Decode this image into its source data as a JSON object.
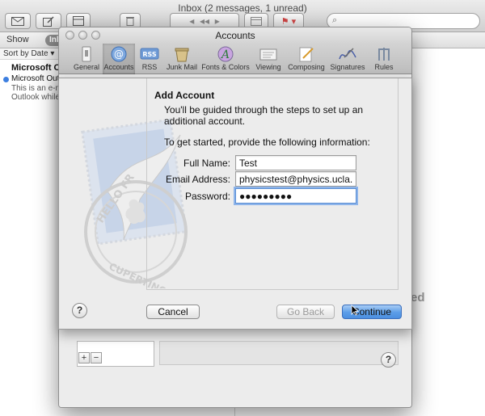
{
  "mail": {
    "window_title": "Inbox (2 messages, 1 unread)",
    "show_label": "Show",
    "inbox_pill": "Inbox",
    "sort_label": "Sort by Date ▾",
    "message": {
      "sender": "Microsoft Outlo",
      "subject": "Microsoft Outlo",
      "preview_line1": "This is an e-m",
      "preview_line2": "Outlook while"
    },
    "background_text": "ed"
  },
  "prefs": {
    "title": "Accounts",
    "tabs": [
      {
        "label": "General",
        "icon": "general-switch-icon"
      },
      {
        "label": "Accounts",
        "icon": "at-sign-icon"
      },
      {
        "label": "RSS",
        "icon": "rss-icon"
      },
      {
        "label": "Junk Mail",
        "icon": "junk-mail-icon"
      },
      {
        "label": "Fonts & Colors",
        "icon": "fonts-colors-icon"
      },
      {
        "label": "Viewing",
        "icon": "viewing-icon"
      },
      {
        "label": "Composing",
        "icon": "composing-icon"
      },
      {
        "label": "Signatures",
        "icon": "signatures-icon"
      },
      {
        "label": "Rules",
        "icon": "rules-icon"
      }
    ],
    "add_symbol": "+",
    "remove_symbol": "−",
    "help_symbol": "?"
  },
  "sheet": {
    "heading": "Add Account",
    "intro": "You'll be guided through the steps to set up an additional account.",
    "instruction": "To get started, provide the following information:",
    "full_name_label": "Full Name:",
    "full_name_value": "Test",
    "email_label": "Email Address:",
    "email_value": "physicstest@physics.ucla.edu",
    "password_label": "Password:",
    "password_value": "●●●●●●●●●",
    "help_symbol": "?",
    "cancel_label": "Cancel",
    "back_label": "Go Back",
    "continue_label": "Continue"
  },
  "colors": {
    "accent": "#5b9de8",
    "focus_ring": "#8db4ea",
    "unread_dot": "#3d7fe0"
  }
}
